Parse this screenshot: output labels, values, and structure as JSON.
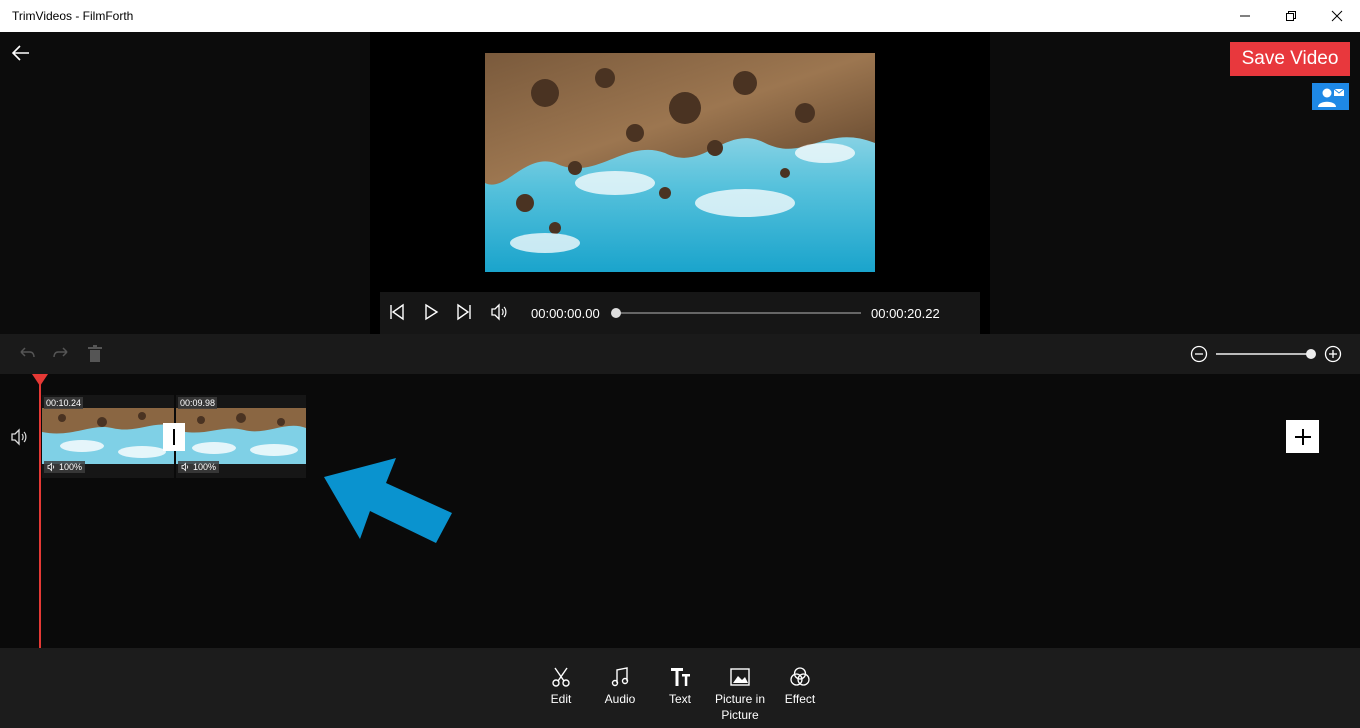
{
  "window": {
    "title": "TrimVideos - FilmForth"
  },
  "header": {
    "save_label": "Save Video"
  },
  "player": {
    "current_time": "00:00:00.00",
    "total_time": "00:00:20.22",
    "progress": 0
  },
  "zoom": {
    "level": 1.0
  },
  "timeline": {
    "clips": [
      {
        "duration": "00:10.24",
        "volume": "100%"
      },
      {
        "duration": "00:09.98",
        "volume": "100%"
      }
    ]
  },
  "bottom_bar": {
    "items": [
      {
        "label": "Edit",
        "icon": "scissors-icon"
      },
      {
        "label": "Audio",
        "icon": "music-note-icon"
      },
      {
        "label": "Text",
        "icon": "text-icon"
      },
      {
        "label": "Picture in Picture",
        "icon": "image-icon"
      },
      {
        "label": "Effect",
        "icon": "effect-circles-icon"
      }
    ]
  },
  "colors": {
    "accent_red": "#e8383d",
    "contact_blue": "#1e88e5",
    "arrow_blue": "#0a93cf",
    "playhead": "#e53935"
  }
}
